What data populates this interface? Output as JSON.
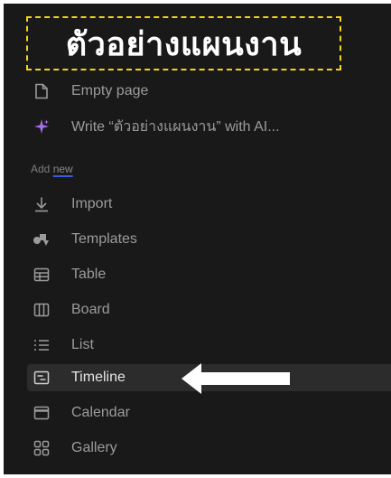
{
  "page_title": "ตัวอย่างแผนงาน",
  "menu": {
    "empty_page": {
      "label": "Empty page",
      "icon": "page-icon"
    },
    "write_ai": {
      "label": "Write “ตัวอย่างแผนงาน” with AI...",
      "icon": "sparkle-icon"
    }
  },
  "add_new": {
    "prefix": "Add",
    "suffix": "new",
    "items": [
      {
        "label": "Import",
        "icon": "download-arrow-icon"
      },
      {
        "label": "Templates",
        "icon": "shapes-icon"
      },
      {
        "label": "Table",
        "icon": "table-icon"
      },
      {
        "label": "Board",
        "icon": "board-icon"
      },
      {
        "label": "List",
        "icon": "list-icon"
      },
      {
        "label": "Timeline",
        "icon": "timeline-icon"
      },
      {
        "label": "Calendar",
        "icon": "calendar-icon"
      },
      {
        "label": "Gallery",
        "icon": "gallery-icon"
      }
    ]
  },
  "colors": {
    "background": "#191919",
    "highlight": "#f2d31b",
    "accent": "#3b5bdb",
    "ai_sparkle": "#a770ef"
  }
}
